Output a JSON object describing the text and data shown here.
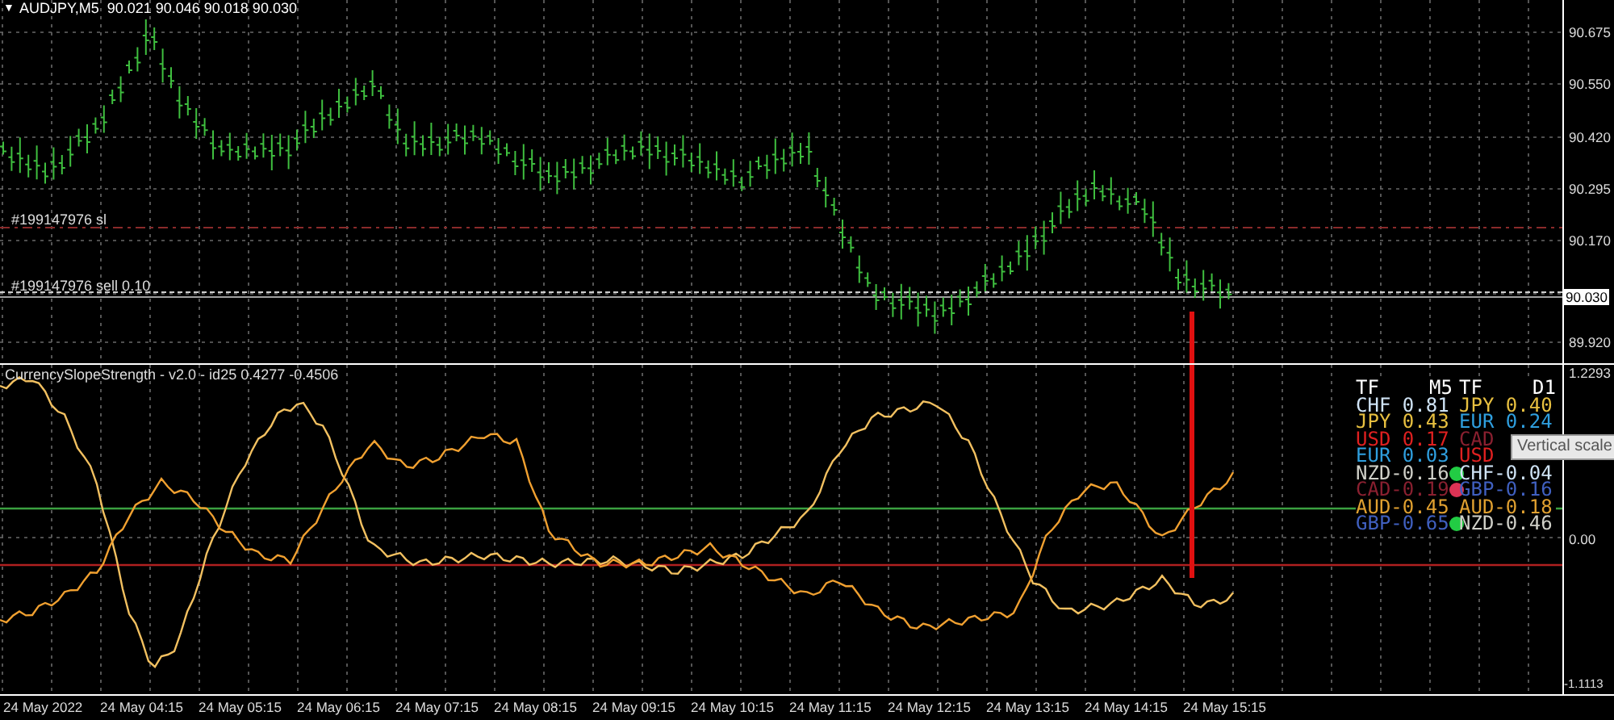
{
  "price_chart": {
    "header_marker": "▼",
    "header": "AUDJPY,M5  90.021 90.046 90.018 90.030",
    "order_labels": [
      "#199147976 sl",
      "#199147976 sell 0.10"
    ],
    "price_scale": [
      "90.675",
      "90.550",
      "90.420",
      "90.295",
      "90.170",
      "89.920"
    ],
    "current_price": "90.030"
  },
  "indicator": {
    "title": "CurrencySlopeStrength - v2.0 - id25 0.4277 -0.4506",
    "scale": [
      "1.2293",
      "0.00",
      "-1.1113"
    ],
    "strength_table": {
      "header_left": [
        "TF",
        "M5"
      ],
      "header_right": [
        "TF",
        "D1"
      ],
      "rows": [
        {
          "left": {
            "text": "CHF 0.81",
            "color": "#cfe3f5"
          },
          "right": {
            "text": "JPY 0.40",
            "color": "#e8c040"
          }
        },
        {
          "left": {
            "text": "JPY 0.43",
            "color": "#e8c040"
          },
          "right": {
            "text": "EUR 0.24",
            "color": "#2f9fdf"
          }
        },
        {
          "left": {
            "text": "USD 0.17",
            "color": "#e02020"
          },
          "right": {
            "text": "CAD",
            "color": "#8a2030"
          }
        },
        {
          "left": {
            "text": "EUR 0.03",
            "color": "#2f9fdf"
          },
          "right": {
            "text": "USD",
            "color": "#e02020"
          }
        },
        {
          "left": {
            "text": "NZD-0.16",
            "color": "#d0d0c8"
          },
          "dot": {
            "color": "#22cc44"
          },
          "right": {
            "text": "CHF-0.04",
            "color": "#cfe3f5"
          }
        },
        {
          "left": {
            "text": "CAD-0.19",
            "color": "#8a2030"
          },
          "dot": {
            "color": "#dd3355"
          },
          "right": {
            "text": "GBP-0.16",
            "color": "#4060c0"
          }
        },
        {
          "left": {
            "text": "AUD-0.45",
            "color": "#e0a030"
          },
          "right": {
            "text": "AUD-0.18",
            "color": "#e0a030"
          }
        },
        {
          "left": {
            "text": "GBP-0.65",
            "color": "#4060c0"
          },
          "dot": {
            "color": "#22cc44"
          },
          "right": {
            "text": "NZD-0.46",
            "color": "#d0d0c8"
          }
        }
      ]
    },
    "tooltip": "Vertical scale"
  },
  "time_axis": [
    "24 May 2022",
    "24 May 04:15",
    "24 May 05:15",
    "24 May 06:15",
    "24 May 07:15",
    "24 May 08:15",
    "24 May 09:15",
    "24 May 10:15",
    "24 May 11:15",
    "24 May 12:15",
    "24 May 13:15",
    "24 May 14:15",
    "24 May 15:15"
  ]
}
